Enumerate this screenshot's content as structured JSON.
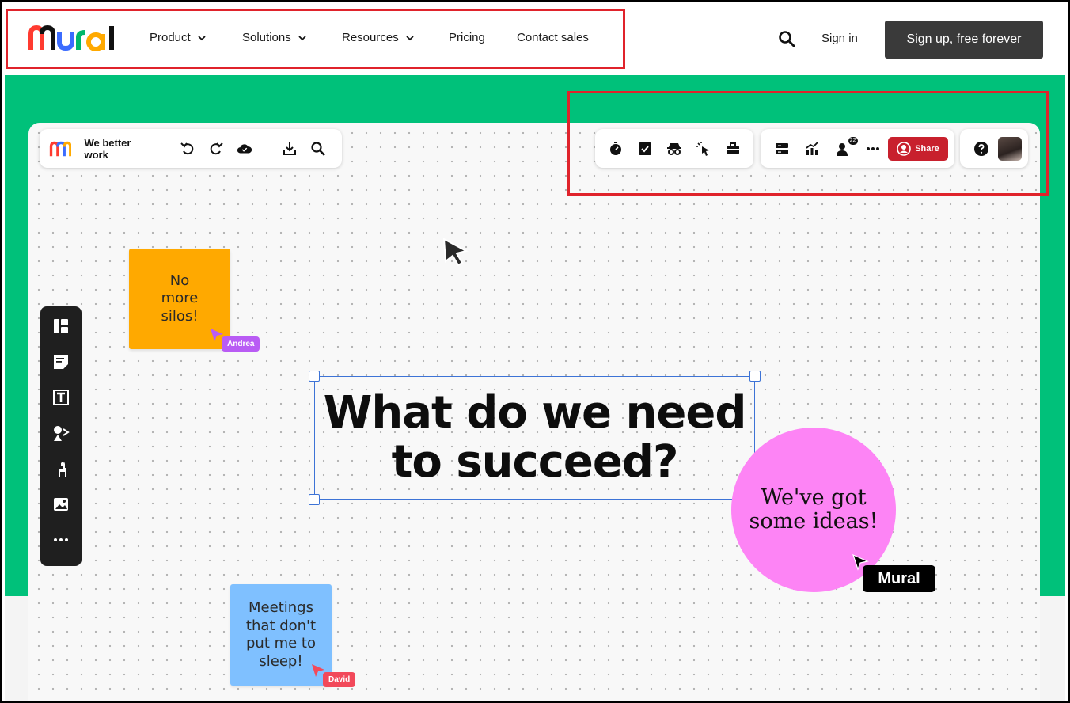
{
  "nav": {
    "items": [
      {
        "label": "Product",
        "has_dropdown": true
      },
      {
        "label": "Solutions",
        "has_dropdown": true
      },
      {
        "label": "Resources",
        "has_dropdown": true
      },
      {
        "label": "Pricing",
        "has_dropdown": false
      },
      {
        "label": "Contact sales",
        "has_dropdown": false
      }
    ],
    "sign_in": "Sign in",
    "sign_up": "Sign up, free forever",
    "logo_text": "Mural"
  },
  "colors": {
    "hero_green": "#00c17a",
    "signup_bg": "#3a3a3a",
    "share_red": "#c8202d",
    "highlight_red": "#e0232b",
    "sticky_orange": "#ffa900",
    "sticky_blue": "#7fc0ff",
    "circle_pink": "#fd84f5",
    "selection_blue": "#3d73d6"
  },
  "board": {
    "name": "We better work",
    "toolbar_left_icons": [
      "undo-icon",
      "redo-icon",
      "cloud-saved-icon",
      "download-icon",
      "search-icon"
    ],
    "toolbar_right_group1": [
      "timer-icon",
      "checkbox-icon",
      "private-mode-icon",
      "celebrate-cursor-icon",
      "toolbox-icon"
    ],
    "toolbar_right_group2": [
      "outline-icon",
      "activity-chart-icon",
      "collaborators-icon",
      "more-icon"
    ],
    "collaborator_count": "22",
    "share_label": "Share",
    "help_icon": "help-icon",
    "side_tools": [
      "templates-icon",
      "sticky-note-icon",
      "text-icon",
      "shapes-icon",
      "llama-icon",
      "image-icon",
      "more-icon"
    ]
  },
  "canvas": {
    "sticky_orange_text": [
      "No",
      "more",
      "silos!"
    ],
    "sticky_blue_text": [
      "Meetings",
      "that don't",
      "put me to",
      "sleep!"
    ],
    "andrea_tag": "Andrea",
    "david_tag": "David",
    "heading_lines": [
      "What do we need",
      "to succeed?"
    ],
    "circle_lines": [
      "We've got",
      "some ideas!"
    ],
    "mural_tag": "Mural"
  }
}
